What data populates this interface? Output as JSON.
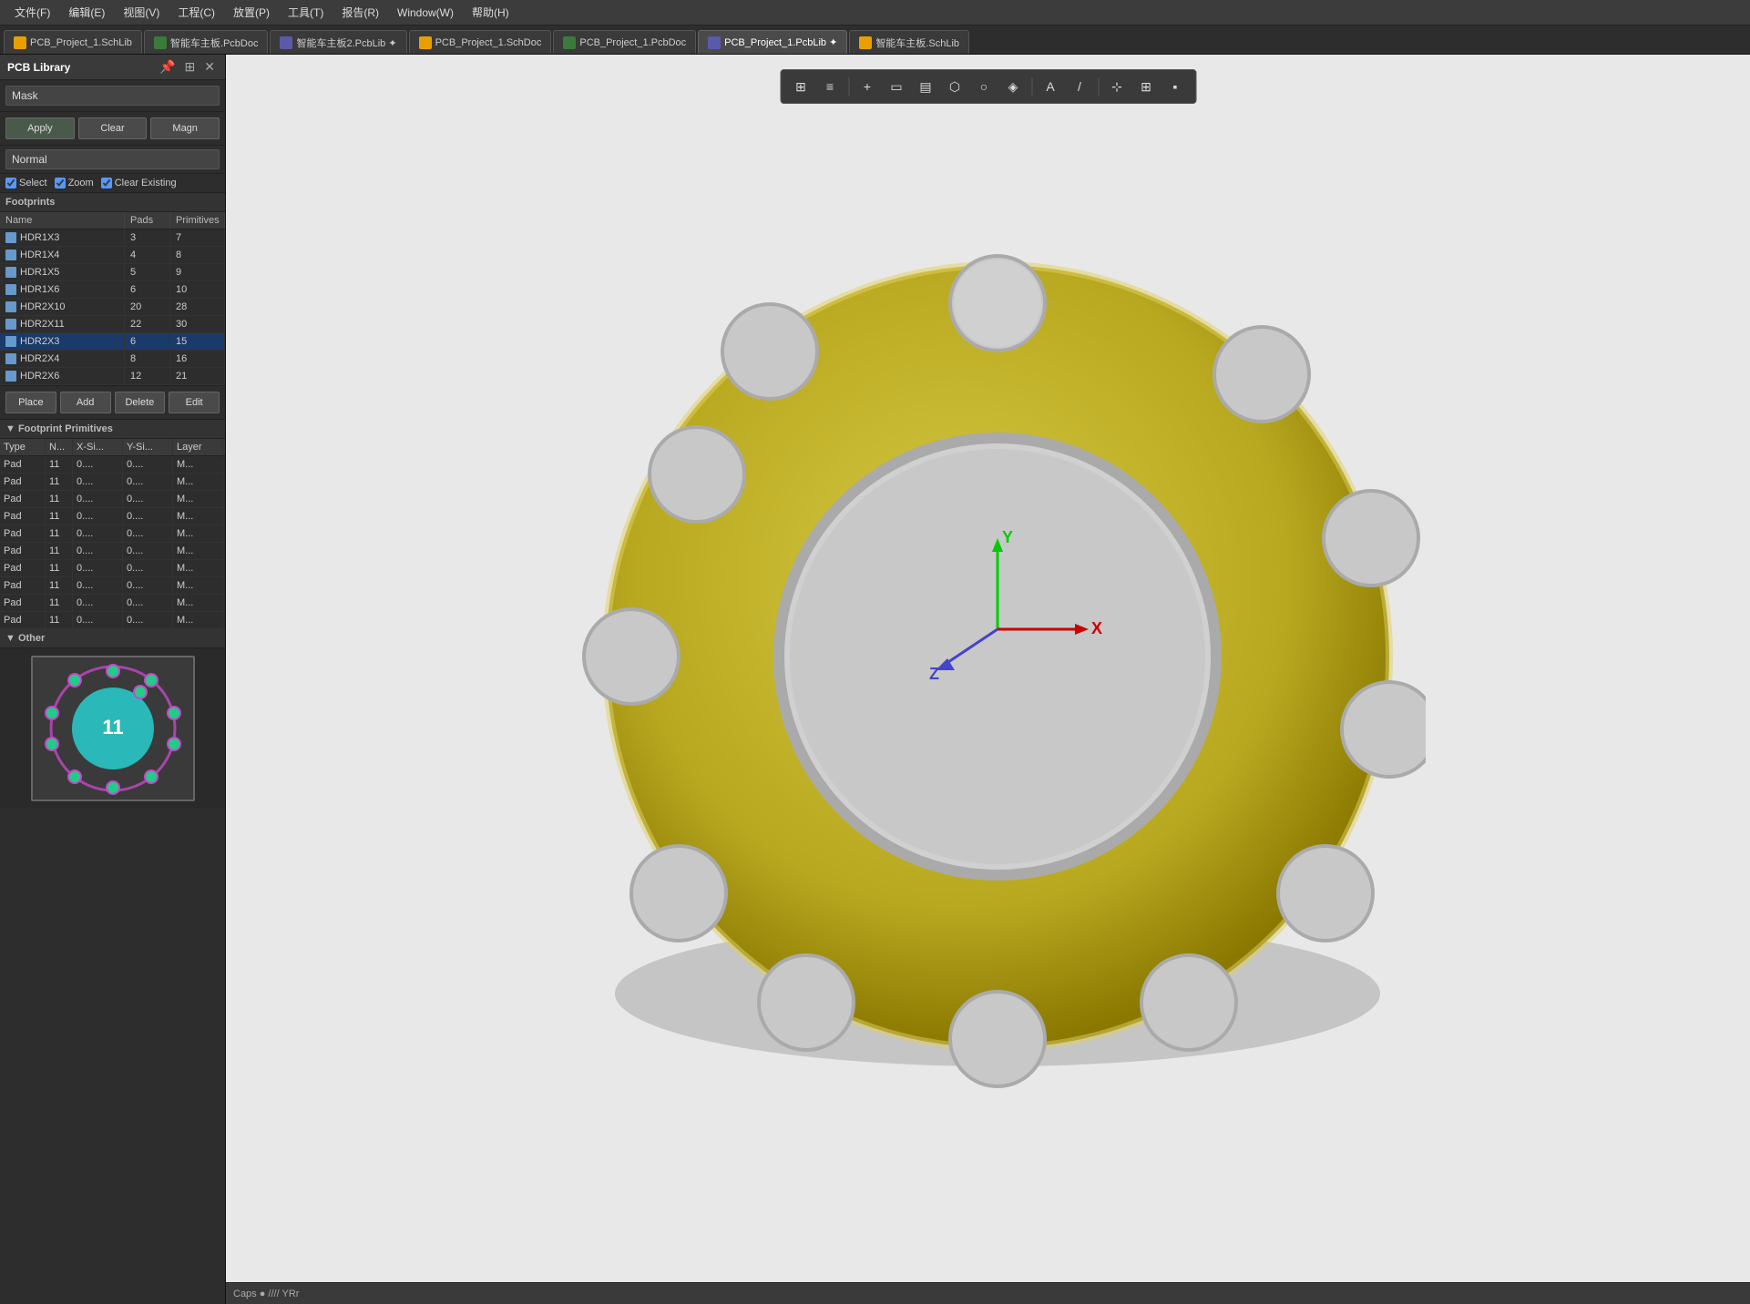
{
  "menu": {
    "items": [
      "文件(F)",
      "编辑(E)",
      "视图(V)",
      "工程(C)",
      "放置(P)",
      "工具(T)",
      "报告(R)",
      "Window(W)",
      "帮助(H)"
    ]
  },
  "tabs": [
    {
      "label": "PCB_Project_1.SchLib",
      "type": "schlib",
      "active": false
    },
    {
      "label": "智能车主板.PcbDoc",
      "type": "pcbdoc",
      "active": false
    },
    {
      "label": "智能车主板2.PcbLib ✦",
      "type": "pcblib",
      "active": false
    },
    {
      "label": "PCB_Project_1.SchDoc",
      "type": "schlib",
      "active": false
    },
    {
      "label": "PCB_Project_1.PcbDoc",
      "type": "pcbdoc",
      "active": false
    },
    {
      "label": "PCB_Project_1.PcbLib ✦",
      "type": "pcblib",
      "active": true
    },
    {
      "label": "智能车主板.SchLib",
      "type": "schlib",
      "active": false
    }
  ],
  "panel": {
    "title": "PCB Library",
    "mask_label": "Mask",
    "mask_placeholder": "Mask",
    "buttons": {
      "apply": "Apply",
      "clear": "Clear",
      "magn": "Magn"
    },
    "normal_options": [
      "Normal"
    ],
    "checkboxes": {
      "select": "Select",
      "zoom": "Zoom",
      "clear_existing": "Clear Existing"
    },
    "footprints_label": "Footprints",
    "table_headers": [
      "Name",
      "Pads",
      "Primitives"
    ],
    "rows": [
      {
        "name": "HDR1X3",
        "pads": "3",
        "primitives": "7"
      },
      {
        "name": "HDR1X4",
        "pads": "4",
        "primitives": "8"
      },
      {
        "name": "HDR1X5",
        "pads": "5",
        "primitives": "9"
      },
      {
        "name": "HDR1X6",
        "pads": "6",
        "primitives": "10"
      },
      {
        "name": "HDR2X10",
        "pads": "20",
        "primitives": "28"
      },
      {
        "name": "HDR2X11",
        "pads": "22",
        "primitives": "30"
      },
      {
        "name": "HDR2X3",
        "pads": "6",
        "primitives": "15"
      },
      {
        "name": "HDR2X4",
        "pads": "8",
        "primitives": "16"
      },
      {
        "name": "HDR2X6",
        "pads": "12",
        "primitives": "21"
      }
    ],
    "action_buttons": [
      "Place",
      "Add",
      "Delete",
      "Edit"
    ],
    "primitives_label": "Footprint Primitives",
    "primitives_headers": [
      "Type",
      "N...",
      "X-Si...",
      "Y-Si...",
      "Layer"
    ],
    "primitives_rows": [
      {
        "type": "Pad",
        "n": "11",
        "x": "0....",
        "y": "0....",
        "layer": "M..."
      },
      {
        "type": "Pad",
        "n": "11",
        "x": "0....",
        "y": "0....",
        "layer": "M..."
      },
      {
        "type": "Pad",
        "n": "11",
        "x": "0....",
        "y": "0....",
        "layer": "M..."
      },
      {
        "type": "Pad",
        "n": "11",
        "x": "0....",
        "y": "0....",
        "layer": "M..."
      },
      {
        "type": "Pad",
        "n": "11",
        "x": "0....",
        "y": "0....",
        "layer": "M..."
      },
      {
        "type": "Pad",
        "n": "11",
        "x": "0....",
        "y": "0....",
        "layer": "M..."
      },
      {
        "type": "Pad",
        "n": "11",
        "x": "0....",
        "y": "0....",
        "layer": "M..."
      },
      {
        "type": "Pad",
        "n": "11",
        "x": "0....",
        "y": "0....",
        "layer": "M..."
      },
      {
        "type": "Pad",
        "n": "11",
        "x": "0....",
        "y": "0....",
        "layer": "M..."
      },
      {
        "type": "Pad",
        "n": "11",
        "x": "0....",
        "y": "0....",
        "layer": "M..."
      }
    ],
    "other_label": "Other",
    "preview_number": "11"
  },
  "toolbar_icons": [
    "filter",
    "route",
    "plus",
    "rect",
    "bar-chart",
    "shield",
    "circle",
    "pin",
    "text",
    "line",
    "measure",
    "grid",
    "square"
  ],
  "axes": {
    "x_label": "X",
    "y_label": "Y",
    "z_label": "Z"
  },
  "status": "Caps ● //// YRr"
}
